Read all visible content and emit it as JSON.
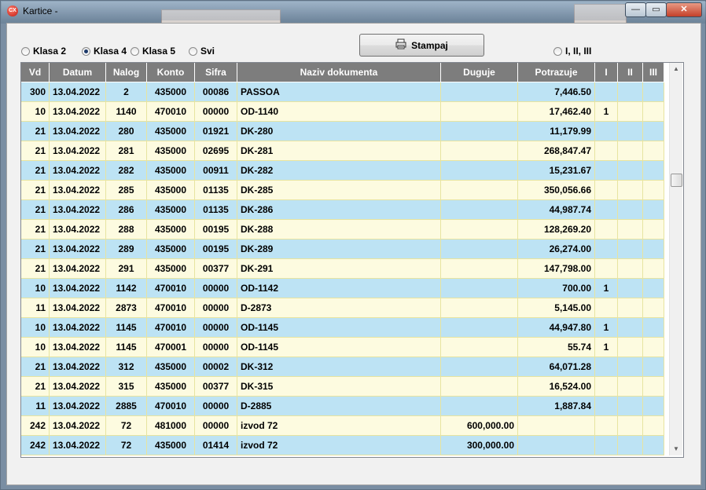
{
  "window": {
    "title": "Kartice  -",
    "icon": "app-logo-icon",
    "min_glyph": "—",
    "max_glyph": "▭",
    "close_glyph": "✕"
  },
  "filters": {
    "klasa2": "Klasa 2",
    "klasa4": "Klasa 4",
    "klasa5": "Klasa 5",
    "svi": "Svi",
    "roman": "I, II, III",
    "selected": "Klasa 4"
  },
  "print_button": {
    "label": "Stampaj",
    "icon": "printer-icon"
  },
  "table": {
    "columns": [
      "Vd",
      "Datum",
      "Nalog",
      "Konto",
      "Sifra",
      "Naziv dokumenta",
      "Duguje",
      "Potrazuje",
      "I",
      "II",
      "III"
    ],
    "rows": [
      [
        "300",
        "13.04.2022",
        "2",
        "435000",
        "00086",
        "PASSOA",
        "",
        "7,446.50",
        "",
        "",
        ""
      ],
      [
        "10",
        "13.04.2022",
        "1140",
        "470010",
        "00000",
        "OD-1140",
        "",
        "17,462.40",
        "1",
        "",
        ""
      ],
      [
        "21",
        "13.04.2022",
        "280",
        "435000",
        "01921",
        "DK-280",
        "",
        "11,179.99",
        "",
        "",
        ""
      ],
      [
        "21",
        "13.04.2022",
        "281",
        "435000",
        "02695",
        "DK-281",
        "",
        "268,847.47",
        "",
        "",
        ""
      ],
      [
        "21",
        "13.04.2022",
        "282",
        "435000",
        "00911",
        "DK-282",
        "",
        "15,231.67",
        "",
        "",
        ""
      ],
      [
        "21",
        "13.04.2022",
        "285",
        "435000",
        "01135",
        "DK-285",
        "",
        "350,056.66",
        "",
        "",
        ""
      ],
      [
        "21",
        "13.04.2022",
        "286",
        "435000",
        "01135",
        "DK-286",
        "",
        "44,987.74",
        "",
        "",
        ""
      ],
      [
        "21",
        "13.04.2022",
        "288",
        "435000",
        "00195",
        "DK-288",
        "",
        "128,269.20",
        "",
        "",
        ""
      ],
      [
        "21",
        "13.04.2022",
        "289",
        "435000",
        "00195",
        "DK-289",
        "",
        "26,274.00",
        "",
        "",
        ""
      ],
      [
        "21",
        "13.04.2022",
        "291",
        "435000",
        "00377",
        "DK-291",
        "",
        "147,798.00",
        "",
        "",
        ""
      ],
      [
        "10",
        "13.04.2022",
        "1142",
        "470010",
        "00000",
        "OD-1142",
        "",
        "700.00",
        "1",
        "",
        ""
      ],
      [
        "11",
        "13.04.2022",
        "2873",
        "470010",
        "00000",
        "D-2873",
        "",
        "5,145.00",
        "",
        "",
        ""
      ],
      [
        "10",
        "13.04.2022",
        "1145",
        "470010",
        "00000",
        "OD-1145",
        "",
        "44,947.80",
        "1",
        "",
        ""
      ],
      [
        "10",
        "13.04.2022",
        "1145",
        "470001",
        "00000",
        "OD-1145",
        "",
        "55.74",
        "1",
        "",
        ""
      ],
      [
        "21",
        "13.04.2022",
        "312",
        "435000",
        "00002",
        "DK-312",
        "",
        "64,071.28",
        "",
        "",
        ""
      ],
      [
        "21",
        "13.04.2022",
        "315",
        "435000",
        "00377",
        "DK-315",
        "",
        "16,524.00",
        "",
        "",
        ""
      ],
      [
        "11",
        "13.04.2022",
        "2885",
        "470010",
        "00000",
        "D-2885",
        "",
        "1,887.84",
        "",
        "",
        ""
      ],
      [
        "242",
        "13.04.2022",
        "72",
        "481000",
        "00000",
        "izvod 72",
        "600,000.00",
        "",
        "",
        "",
        ""
      ],
      [
        "242",
        "13.04.2022",
        "72",
        "435000",
        "01414",
        "izvod 72",
        "300,000.00",
        "",
        "",
        "",
        ""
      ]
    ]
  },
  "scrollbar": {
    "up_icon": "scroll-up-icon",
    "down_icon": "scroll-down-icon"
  }
}
